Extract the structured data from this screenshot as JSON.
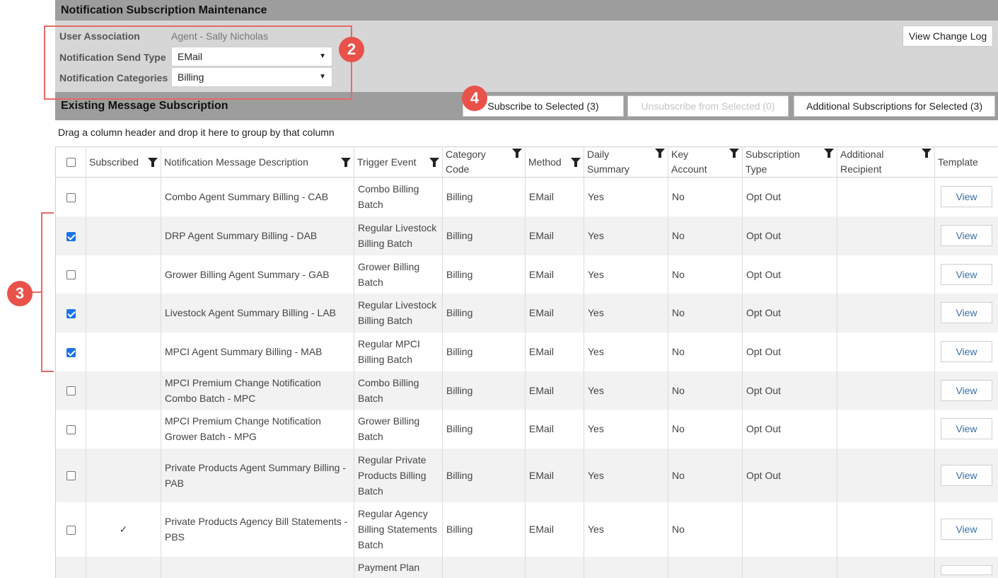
{
  "title": "Notification Subscription Maintenance",
  "filters": {
    "user_association_label": "User Association",
    "user_association_value": "Agent - Sally Nicholas",
    "send_type_label": "Notification Send Type",
    "send_type_value": "EMail",
    "categories_label": "Notification Categories",
    "categories_value": "Billing"
  },
  "view_change_log_label": "View Change Log",
  "section_title": "Existing Message Subscription",
  "actions": {
    "subscribe": "Subscribe to Selected (3)",
    "unsubscribe": "Unsubscribe from Selected (0)",
    "additional": "Additional Subscriptions for Selected (3)"
  },
  "group_hint": "Drag a column header and drop it here to group by that column",
  "columns": {
    "subscribed": "Subscribed",
    "description": "Notification Message Description",
    "trigger": "Trigger Event",
    "category_1": "Category",
    "category_2": "Code",
    "method": "Method",
    "daily_1": "Daily",
    "daily_2": "Summary",
    "key_1": "Key",
    "key_2": "Account",
    "subtype_1": "Subscription",
    "subtype_2": "Type",
    "addl_1": "Additional",
    "addl_2": "Recipient",
    "template": "Template"
  },
  "rows": [
    {
      "checked": false,
      "subscribed": "",
      "desc": "Combo Agent Summary Billing - CAB",
      "trigger": "Combo Billing Batch",
      "category": "Billing",
      "method": "EMail",
      "daily": "Yes",
      "key": "No",
      "subtype": "Opt Out",
      "addl": "",
      "template": "View"
    },
    {
      "checked": true,
      "subscribed": "",
      "desc": "DRP Agent Summary Billing - DAB",
      "trigger": "Regular Livestock Billing Batch",
      "category": "Billing",
      "method": "EMail",
      "daily": "Yes",
      "key": "No",
      "subtype": "Opt Out",
      "addl": "",
      "template": "View"
    },
    {
      "checked": false,
      "subscribed": "",
      "desc": "Grower Billing Agent Summary - GAB",
      "trigger": "Grower Billing Batch",
      "category": "Billing",
      "method": "EMail",
      "daily": "Yes",
      "key": "No",
      "subtype": "Opt Out",
      "addl": "",
      "template": "View"
    },
    {
      "checked": true,
      "subscribed": "",
      "desc": "Livestock Agent Summary Billing - LAB",
      "trigger": "Regular Livestock Billing Batch",
      "category": "Billing",
      "method": "EMail",
      "daily": "Yes",
      "key": "No",
      "subtype": "Opt Out",
      "addl": "",
      "template": "View"
    },
    {
      "checked": true,
      "subscribed": "",
      "desc": "MPCI Agent Summary Billing - MAB",
      "trigger": "Regular MPCI Billing Batch",
      "category": "Billing",
      "method": "EMail",
      "daily": "Yes",
      "key": "No",
      "subtype": "Opt Out",
      "addl": "",
      "template": "View"
    },
    {
      "checked": false,
      "subscribed": "",
      "desc": "MPCI Premium Change Notification Combo Batch - MPC",
      "trigger": "Combo Billing Batch",
      "category": "Billing",
      "method": "EMail",
      "daily": "Yes",
      "key": "No",
      "subtype": "Opt Out",
      "addl": "",
      "template": "View"
    },
    {
      "checked": false,
      "subscribed": "",
      "desc": "MPCI Premium Change Notification Grower Batch - MPG",
      "trigger": "Grower Billing Batch",
      "category": "Billing",
      "method": "EMail",
      "daily": "Yes",
      "key": "No",
      "subtype": "Opt Out",
      "addl": "",
      "template": "View"
    },
    {
      "checked": false,
      "subscribed": "",
      "desc": "Private Products Agent Summary Billing - PAB",
      "trigger": "Regular Private Products Billing Batch",
      "category": "Billing",
      "method": "EMail",
      "daily": "Yes",
      "key": "No",
      "subtype": "Opt Out",
      "addl": "",
      "template": "View"
    },
    {
      "checked": false,
      "subscribed": "✓",
      "desc": "Private Products Agency Bill Statements - PBS",
      "trigger": "Regular Agency Billing Statements Batch",
      "category": "Billing",
      "method": "EMail",
      "daily": "Yes",
      "key": "No",
      "subtype": "",
      "addl": "",
      "template": "View"
    },
    {
      "checked": false,
      "subscribed": "",
      "desc": "",
      "trigger": "Payment Plan",
      "category": "",
      "method": "",
      "daily": "",
      "key": "",
      "subtype": "",
      "addl": "",
      "template": ""
    }
  ],
  "callouts": {
    "c2": "2",
    "c3": "3",
    "c4": "4"
  },
  "colors": {
    "accent_red": "#e8524a",
    "header_gray": "#9d9d9d",
    "filter_gray": "#d6d6d6",
    "link_blue": "#3a6fa7",
    "check_blue": "#1a73e8"
  }
}
